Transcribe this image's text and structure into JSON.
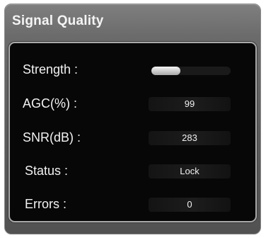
{
  "panel": {
    "title": "Signal Quality"
  },
  "rows": {
    "strength": {
      "label": "Strength :",
      "level": 0.37
    },
    "agc": {
      "label": "AGC(%) :",
      "value": "99"
    },
    "snr": {
      "label": "SNR(dB) :",
      "value": "283"
    },
    "status": {
      "label": "Status :",
      "value": "Lock"
    },
    "errors": {
      "label": "Errors :",
      "value": "0"
    }
  },
  "colors": {
    "panel": "#5b5b5b",
    "inner_background": "#070707",
    "inner_border": "#a9a9a9",
    "text": "#f2f2f2",
    "bar_fill": "#d9d9d9"
  }
}
